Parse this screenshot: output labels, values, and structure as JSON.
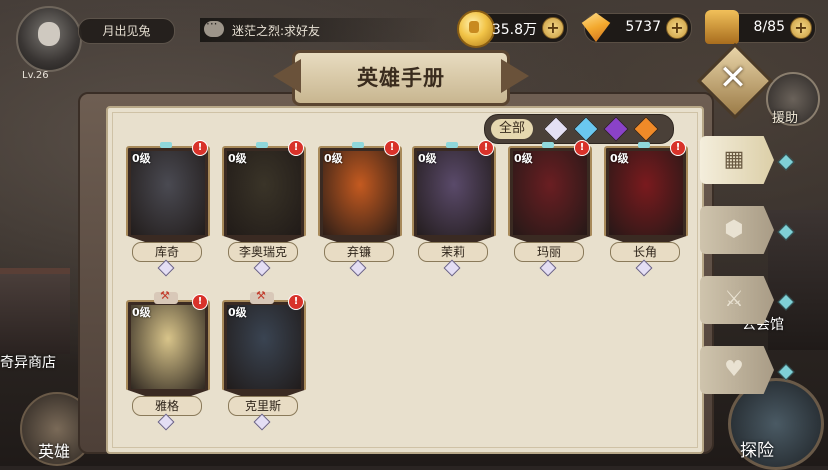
{
  "player": {
    "level_label": "Lv.26",
    "nickname": "月出见兔"
  },
  "chat": {
    "message": "迷茫之烈:求好友"
  },
  "resources": {
    "gold": "35.8万",
    "diamonds": "5737",
    "stamina": "8/85"
  },
  "panel": {
    "title": "英雄手册"
  },
  "filter": {
    "all_label": "全部"
  },
  "side": {
    "help_label": "援助",
    "guild_label": "公会馆",
    "shop_label": "奇异商店"
  },
  "bottom_nav": {
    "hero_label": "英雄",
    "explore_label": "探险"
  },
  "heroes": [
    {
      "level": "0级",
      "name": "库奇",
      "theme": "#4a4a52"
    },
    {
      "level": "0级",
      "name": "李奥瑞克",
      "theme": "#3a3428"
    },
    {
      "level": "0级",
      "name": "弃镰",
      "theme": "#c45a20"
    },
    {
      "level": "0级",
      "name": "茉莉",
      "theme": "#5a4a6a"
    },
    {
      "level": "0级",
      "name": "玛丽",
      "theme": "#6a1e22"
    },
    {
      "level": "0级",
      "name": "长角",
      "theme": "#7a1a1e"
    },
    {
      "level": "0级",
      "name": "雅格",
      "theme": "#d8c48a"
    },
    {
      "level": "0级",
      "name": "克里斯",
      "theme": "#3a4452"
    }
  ]
}
